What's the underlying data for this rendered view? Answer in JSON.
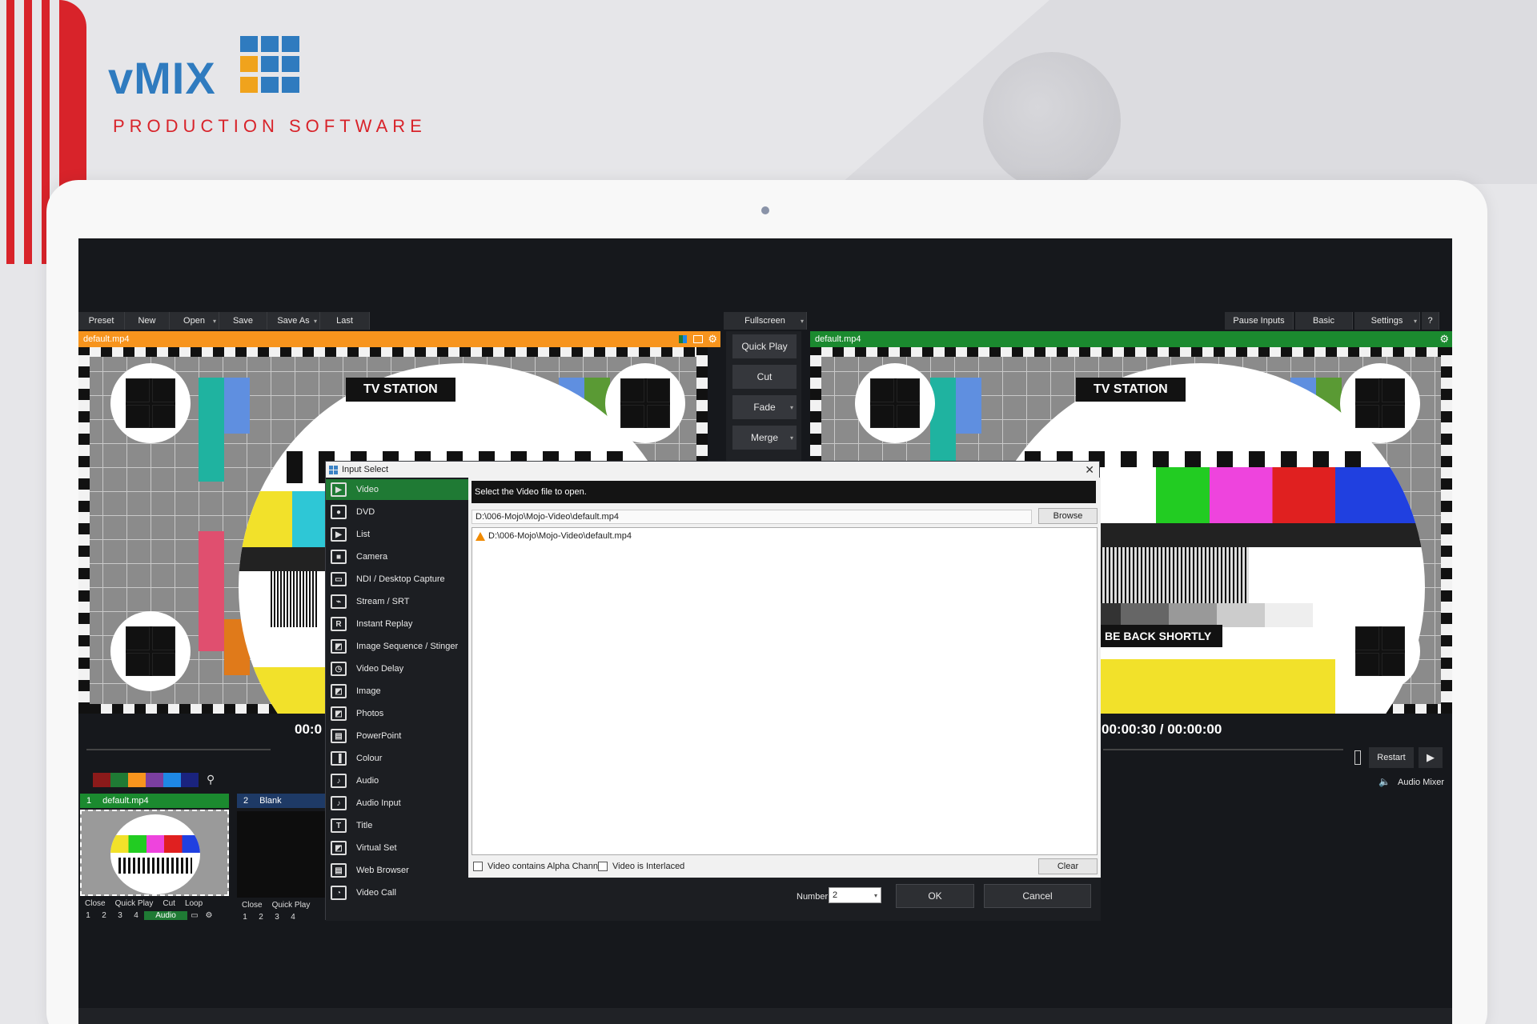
{
  "brand": {
    "name": "vMIX",
    "tagline": "PRODUCTION   SOFTWARE",
    "logo_colors": [
      "#2f7bbf",
      "#2f7bbf",
      "#2f7bbf",
      "#f0a31c",
      "#2f7bbf",
      "#2f7bbf",
      "#f0a31c",
      "#2f7bbf",
      "#2f7bbf"
    ],
    "accent_red": "#d8232a"
  },
  "toolbar": {
    "preset": "Preset",
    "new": "New",
    "open": "Open",
    "save": "Save",
    "save_as": "Save As",
    "last": "Last",
    "fullscreen": "Fullscreen",
    "pause_inputs": "Pause Inputs",
    "basic": "Basic",
    "settings": "Settings",
    "help": "?"
  },
  "preview": {
    "filename": "default.mp4",
    "bar_color": "#f7941d",
    "station": "TV STATION",
    "timecode": "00:0"
  },
  "program": {
    "filename": "default.mp4",
    "bar_color": "#1b8a2f",
    "station": "TV STATION",
    "message": "BE BACK SHORTLY",
    "timecode": "00:00:30  /  00:00:00"
  },
  "transitions": {
    "quick_play": "Quick Play",
    "cut": "Cut",
    "fade": "Fade",
    "merge": "Merge"
  },
  "playback": {
    "restart": "Restart",
    "audio_mixer": "Audio Mixer"
  },
  "color_swatches": [
    "#8b1a1a",
    "#1f7a34",
    "#f7941d",
    "#7b3fa0",
    "#1e88e5",
    "#1a237e"
  ],
  "inputs": [
    {
      "number": "1",
      "name": "default.mp4",
      "head_color": "#1b8a2f",
      "controls": [
        "Close",
        "Quick Play",
        "Cut",
        "Loop"
      ],
      "nums": [
        "1",
        "2",
        "3",
        "4"
      ],
      "audio": "Audio"
    },
    {
      "number": "2",
      "name": "Blank",
      "head_color": "#1e3a66",
      "controls": [
        "Close",
        "Quick Play"
      ],
      "nums": [
        "1",
        "2",
        "3",
        "4"
      ]
    }
  ],
  "dialog": {
    "title": "Input Select",
    "close": "✕",
    "hint": "Select the Video file to open.",
    "path_value": "D:\\006-Mojo\\Mojo-Video\\default.mp4",
    "file_entry": "D:\\006-Mojo\\Mojo-Video\\default.mp4",
    "browse": "Browse",
    "alpha_label": "Video contains Alpha Channel",
    "interlaced_label": "Video is Interlaced",
    "clear": "Clear",
    "number_label": "Number",
    "number_value": "2",
    "ok": "OK",
    "cancel": "Cancel",
    "side_items": [
      {
        "label": "Video",
        "icon": "▶"
      },
      {
        "label": "DVD",
        "icon": "●"
      },
      {
        "label": "List",
        "icon": "▶"
      },
      {
        "label": "Camera",
        "icon": "■"
      },
      {
        "label": "NDI / Desktop Capture",
        "icon": "▭"
      },
      {
        "label": "Stream / SRT",
        "icon": "⌁"
      },
      {
        "label": "Instant Replay",
        "icon": "R"
      },
      {
        "label": "Image Sequence / Stinger",
        "icon": "◩"
      },
      {
        "label": "Video Delay",
        "icon": "◷"
      },
      {
        "label": "Image",
        "icon": "◩"
      },
      {
        "label": "Photos",
        "icon": "◩"
      },
      {
        "label": "PowerPoint",
        "icon": "▤"
      },
      {
        "label": "Colour",
        "icon": "▐"
      },
      {
        "label": "Audio",
        "icon": "♪"
      },
      {
        "label": "Audio Input",
        "icon": "♪"
      },
      {
        "label": "Title",
        "icon": "T"
      },
      {
        "label": "Virtual Set",
        "icon": "◩"
      },
      {
        "label": "Web Browser",
        "icon": "▤"
      },
      {
        "label": "Video Call",
        "icon": "◔"
      }
    ]
  }
}
